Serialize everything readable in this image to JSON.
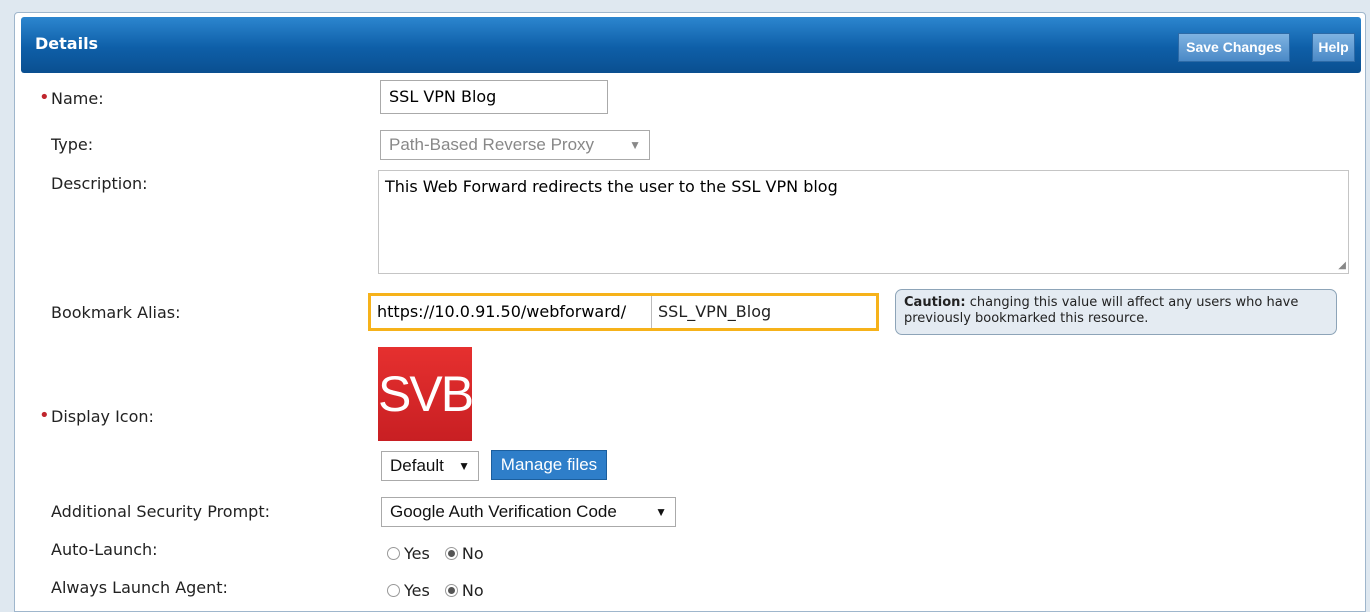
{
  "header": {
    "title": "Details",
    "save_label": "Save Changes",
    "help_label": "Help"
  },
  "fields": {
    "name": {
      "label": "Name:",
      "value": "SSL VPN Blog"
    },
    "type": {
      "label": "Type:",
      "value": "Path-Based Reverse Proxy"
    },
    "description": {
      "label": "Description:",
      "value": "This Web Forward redirects the user to the SSL VPN blog"
    },
    "bookmark_alias": {
      "label": "Bookmark Alias:",
      "prefix": "https://10.0.91.50/webforward/",
      "value": "SSL_VPN_Blog",
      "caution_bold": "Caution:",
      "caution_text": " changing this value will affect any users who have previously bookmarked this resource."
    },
    "display_icon": {
      "label": "Display Icon:",
      "icon_text": "SVB",
      "select_value": "Default",
      "manage_label": "Manage files"
    },
    "security_prompt": {
      "label": "Additional Security Prompt:",
      "value": "Google Auth Verification Code"
    },
    "auto_launch": {
      "label": "Auto-Launch:",
      "yes": "Yes",
      "no": "No",
      "selected": "No"
    },
    "always_launch_agent": {
      "label": "Always Launch Agent:",
      "yes": "Yes",
      "no": "No",
      "selected": "No"
    }
  },
  "colors": {
    "header": "#0e5fa8",
    "required": "#c0262d",
    "highlight": "#f6b21a",
    "icon": "#d42628"
  }
}
